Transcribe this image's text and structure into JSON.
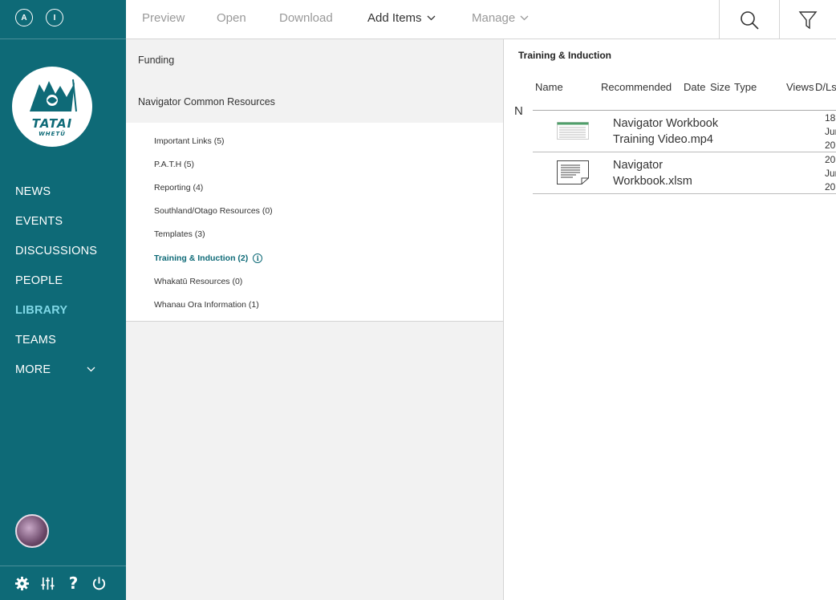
{
  "sidebar": {
    "top_buttons": [
      "A",
      "I"
    ],
    "logo": {
      "line1": "TATAI",
      "line2": "WHETŪ"
    },
    "nav": [
      {
        "label": "NEWS",
        "active": false
      },
      {
        "label": "EVENTS",
        "active": false
      },
      {
        "label": "DISCUSSIONS",
        "active": false
      },
      {
        "label": "PEOPLE",
        "active": false
      },
      {
        "label": "LIBRARY",
        "active": true
      },
      {
        "label": "TEAMS",
        "active": false
      },
      {
        "label": "MORE",
        "active": false
      }
    ],
    "bottom_icons": [
      "gear-icon",
      "sliders-icon",
      "help-icon",
      "power-icon"
    ],
    "help_glyph": "?"
  },
  "toolbar": {
    "preview": "Preview",
    "open": "Open",
    "download": "Download",
    "add_items": "Add Items",
    "manage": "Manage"
  },
  "folders": {
    "top": [
      "Funding",
      "Navigator Common Resources"
    ],
    "children": [
      {
        "label": "Important Links (5)"
      },
      {
        "label": "P.A.T.H (5)"
      },
      {
        "label": "Reporting (4)"
      },
      {
        "label": "Southland/Otago Resources (0)"
      },
      {
        "label": "Templates (3)"
      },
      {
        "label": "Training & Induction (2)",
        "active": true
      },
      {
        "label": "Whakatū Resources (0)"
      },
      {
        "label": "Whanau Ora Information (1)"
      }
    ],
    "info_glyph": "i"
  },
  "files": {
    "title": "Training & Induction",
    "columns": [
      "Name",
      "Recommended",
      "Date",
      "Size",
      "Type",
      "Views",
      "D/Ls"
    ],
    "sort_letter": "N",
    "rows": [
      {
        "name_line1": "Navigator Workbook",
        "name_line2": "Training Video.mp4",
        "date": [
          "18",
          "Jun",
          "20"
        ],
        "thumb": "video-thumbnail"
      },
      {
        "name_line1": "Navigator",
        "name_line2": "Workbook.xlsm",
        "date": [
          "20",
          "Jun",
          "20"
        ],
        "thumb": "document-icon"
      }
    ]
  },
  "colors": {
    "primary": "#0e6a77",
    "active_nav": "#7fd8e6",
    "panel_bg": "#f2f2f2"
  }
}
